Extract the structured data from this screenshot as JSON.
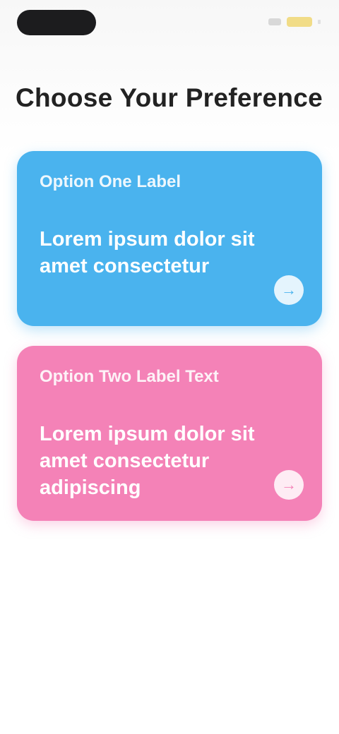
{
  "header": {
    "title": "Choose Your Preference"
  },
  "cards": [
    {
      "eyebrow": "Option One Label",
      "headline": "Lorem ipsum dolor sit amet consectetur",
      "arrow_icon": "→",
      "color": "#4ab3ee"
    },
    {
      "eyebrow": "Option Two Label Text",
      "headline": "Lorem ipsum dolor sit amet consectetur adipiscing",
      "arrow_icon": "→",
      "color": "#f482b7"
    }
  ],
  "colors": {
    "blue_card": "#4ab3ee",
    "pink_card": "#f482b7",
    "title_text": "#222222"
  }
}
